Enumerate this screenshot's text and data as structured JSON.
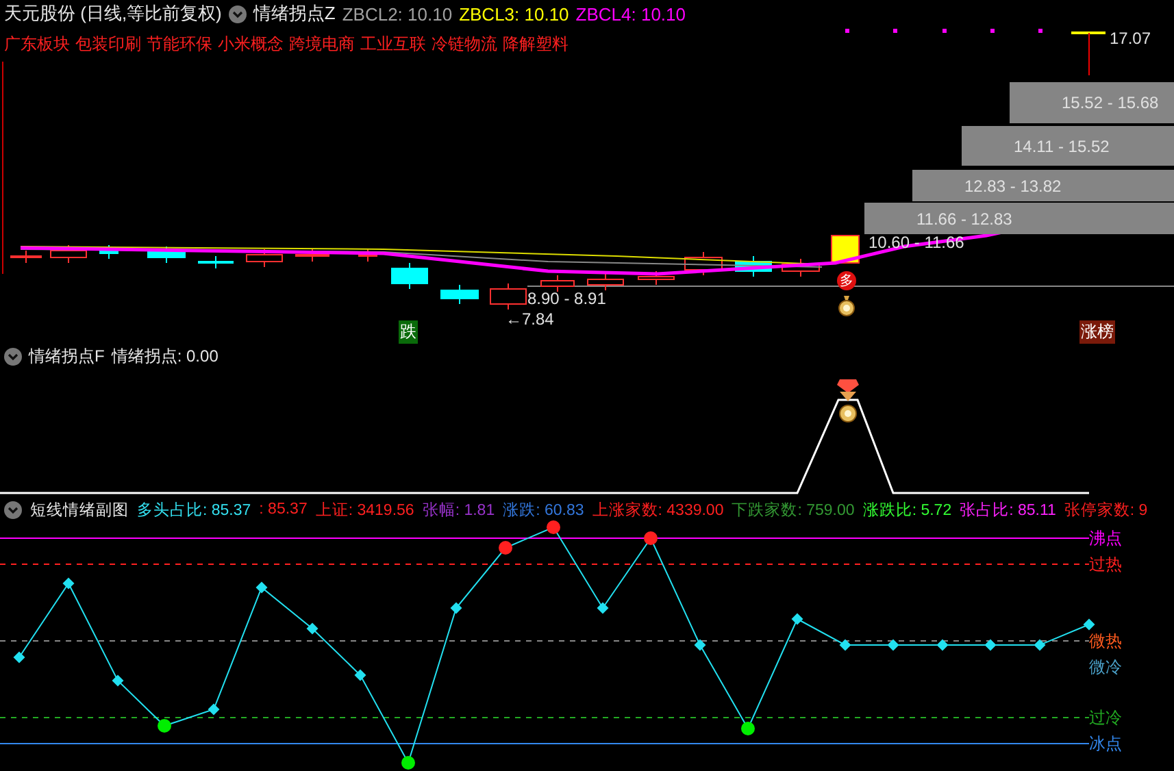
{
  "header": {
    "stock": "天元股份 (日线,等比前复权)",
    "indicator": "情绪拐点Z",
    "values": [
      {
        "text": "ZBCL2: 10.10",
        "color": "#a0a0a0"
      },
      {
        "text": "ZBCL3: 10.10",
        "color": "#ffff00"
      },
      {
        "text": "ZBCL4: 10.10",
        "color": "#ff00ff"
      }
    ]
  },
  "concepts": [
    "广东板块",
    "包装印刷",
    "节能环保",
    "小米概念",
    "跨境电商",
    "工业互联",
    "冷链物流",
    "降解塑料"
  ],
  "main_chart": {
    "high_label": "17.07",
    "range_blocks": [
      "15.52 - 15.68",
      "14.11 - 15.52",
      "12.83 - 13.82",
      "11.66 - 12.83"
    ],
    "current_range": "10.60 - 11.66",
    "low_range": "8.90 - 8.91",
    "low_label": "←7.84",
    "buy_badge": "多",
    "signals": [
      {
        "text": "跌",
        "kind": "fall"
      },
      {
        "text": "涨榜",
        "kind": "rise"
      }
    ]
  },
  "sub_panel": {
    "title": "情绪拐点F",
    "reading": "情绪拐点: 0.00"
  },
  "oscillator": {
    "title": "短线情绪副图",
    "stats": [
      {
        "text": "多头占比: 85.37",
        "color": "#33e0f0"
      },
      {
        "text": ": 85.37",
        "color": "#ff2020"
      },
      {
        "text": "上证: 3419.56",
        "color": "#ff2020"
      },
      {
        "text": "张幅: 1.81",
        "color": "#9933cc"
      },
      {
        "text": "涨跌: 60.83",
        "color": "#3377dd"
      },
      {
        "text": "上涨家数: 4339.00",
        "color": "#ff2020"
      },
      {
        "text": "下跌家数: 759.00",
        "color": "#339933"
      },
      {
        "text": "涨跌比: 5.72",
        "color": "#33ff33"
      },
      {
        "text": "张占比: 85.11",
        "color": "#ff22ff"
      },
      {
        "text": "张停家数: 9",
        "color": "#ff2020"
      }
    ],
    "levels": [
      {
        "label": "沸点",
        "color": "#ff00ff"
      },
      {
        "label": "过热",
        "color": "#ff2020"
      },
      {
        "label": "微热",
        "color": "#ff5a1e"
      },
      {
        "label": "微冷",
        "color": "#4aa0c8"
      },
      {
        "label": "过冷",
        "color": "#22aa22"
      },
      {
        "label": "冰点",
        "color": "#3388ee"
      }
    ]
  }
}
